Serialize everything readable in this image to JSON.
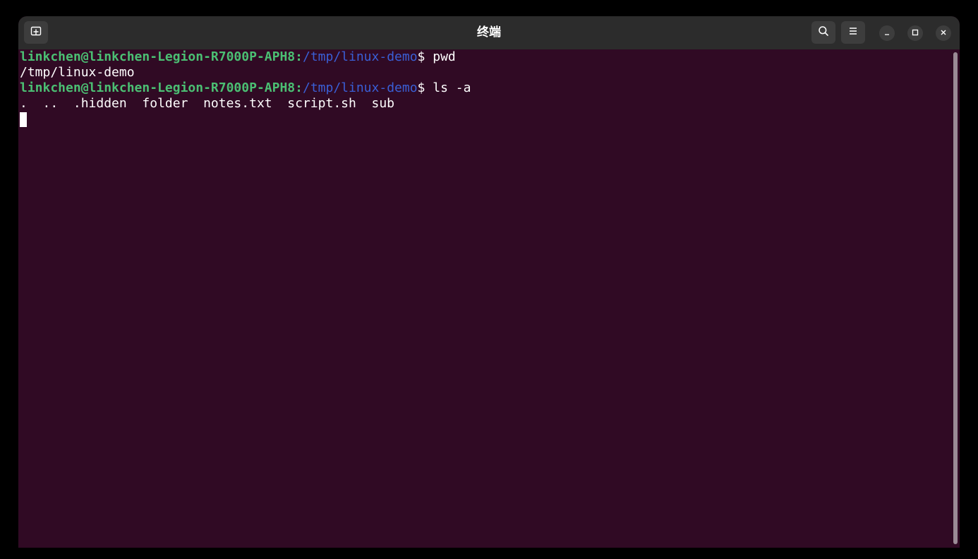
{
  "window": {
    "title": "终端"
  },
  "terminal": {
    "lines": [
      {
        "user": "linkchen@linkchen-Legion-R7000P-APH8",
        "sep": ":",
        "path": "/tmp/linux-demo",
        "prompt": "$ ",
        "cmd": "pwd"
      },
      {
        "output": "/tmp/linux-demo"
      },
      {
        "user": "linkchen@linkchen-Legion-R7000P-APH8",
        "sep": ":",
        "path": "/tmp/linux-demo",
        "prompt": "$ ",
        "cmd": "ls -a"
      },
      {
        "output": ".  ..  .hidden  folder  notes.txt  script.sh  sub"
      }
    ]
  },
  "icons": {
    "new_tab": "new-tab-icon",
    "search": "search-icon",
    "menu": "hamburger-menu-icon",
    "minimize": "minimize-icon",
    "maximize": "maximize-icon",
    "close": "close-icon"
  },
  "colors": {
    "background": "#300a24",
    "titlebar": "#2c2c2c",
    "user": "#4bbf73",
    "path": "#3a5fd6",
    "text": "#ffffff"
  }
}
